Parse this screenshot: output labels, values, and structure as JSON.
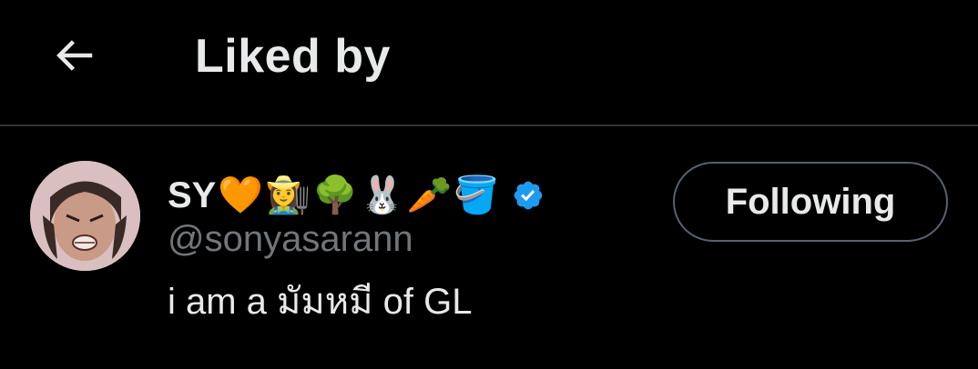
{
  "header": {
    "back_icon": "arrow-left-icon",
    "title": "Liked by"
  },
  "user": {
    "display_name": "SY",
    "name_emojis": [
      "🧡",
      "👩‍🌾",
      "🌳",
      "🐰",
      "🥕",
      "🪣"
    ],
    "verified_icon": "verified-badge-icon",
    "verified_color": "#1d9bf0",
    "handle": "@sonyasarann",
    "bio": "i am a มัมหมี of GL",
    "follow_button_label": "Following"
  },
  "colors": {
    "background": "#000000",
    "primary_text": "#e7e9ea",
    "secondary_text": "#71767b",
    "divider": "#2f3336",
    "button_border": "#536471"
  }
}
